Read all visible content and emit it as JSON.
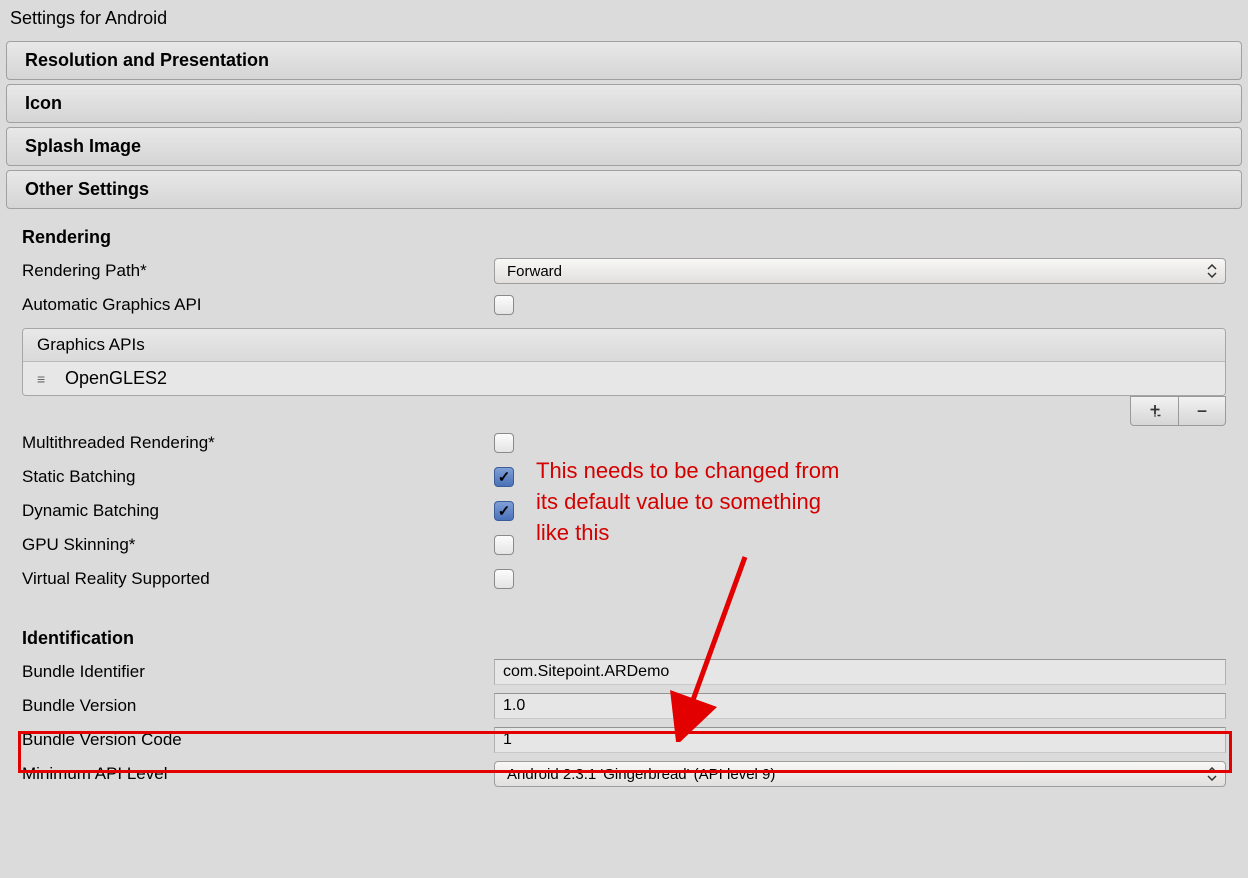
{
  "title": "Settings for Android",
  "sections": {
    "resolution": "Resolution and Presentation",
    "icon": "Icon",
    "splash": "Splash Image",
    "other": "Other Settings"
  },
  "rendering": {
    "header": "Rendering",
    "path_label": "Rendering Path*",
    "path_value": "Forward",
    "auto_api_label": "Automatic Graphics API",
    "apis_header": "Graphics APIs",
    "apis_item": "OpenGLES2",
    "add_btn": "+",
    "remove_btn": "−",
    "multithreaded_label": "Multithreaded Rendering*",
    "static_batching_label": "Static Batching",
    "dynamic_batching_label": "Dynamic Batching",
    "gpu_skinning_label": "GPU Skinning*",
    "vr_label": "Virtual Reality Supported"
  },
  "identification": {
    "header": "Identification",
    "bundle_id_label": "Bundle Identifier",
    "bundle_id_value": "com.Sitepoint.ARDemo",
    "bundle_version_label": "Bundle Version",
    "bundle_version_value": "1.0",
    "bundle_code_label": "Bundle Version Code",
    "bundle_code_value": "1",
    "min_api_label": "Minimum API Level",
    "min_api_value": "Android 2.3.1 'Gingerbread' (API level 9)"
  },
  "annotation": {
    "line1": "This needs to be changed from",
    "line2": "its default value to something",
    "line3": "like this"
  }
}
